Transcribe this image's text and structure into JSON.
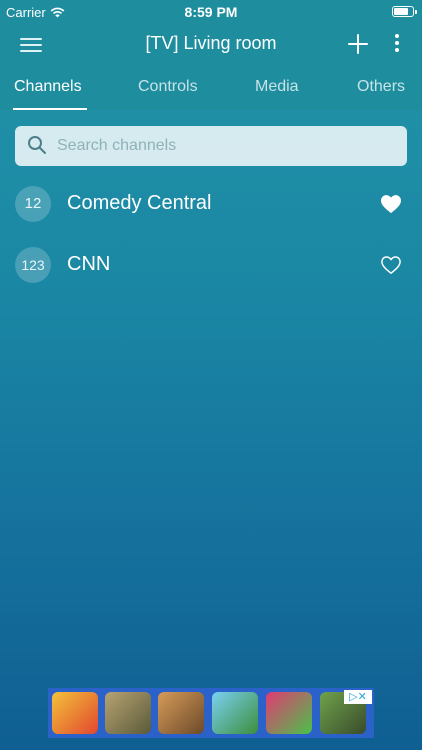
{
  "status_bar": {
    "carrier": "Carrier",
    "time": "8:59 PM"
  },
  "nav": {
    "title": "[TV] Living room"
  },
  "tabs": [
    {
      "label": "Channels",
      "active": true
    },
    {
      "label": "Controls",
      "active": false
    },
    {
      "label": "Media",
      "active": false
    },
    {
      "label": "Others",
      "active": false
    }
  ],
  "search": {
    "placeholder": "Search channels",
    "value": ""
  },
  "channels": [
    {
      "number": "12",
      "name": "Comedy Central",
      "favorite": true
    },
    {
      "number": "123",
      "name": "CNN",
      "favorite": false
    }
  ],
  "ad": {
    "tiles": [
      "subway-surfers",
      "tank-game",
      "soldier-game",
      "jump-game",
      "candy-game",
      "craft-game"
    ]
  },
  "colors": {
    "bar": "#1e8e9f",
    "bg_bottom": "#0f5f92"
  }
}
